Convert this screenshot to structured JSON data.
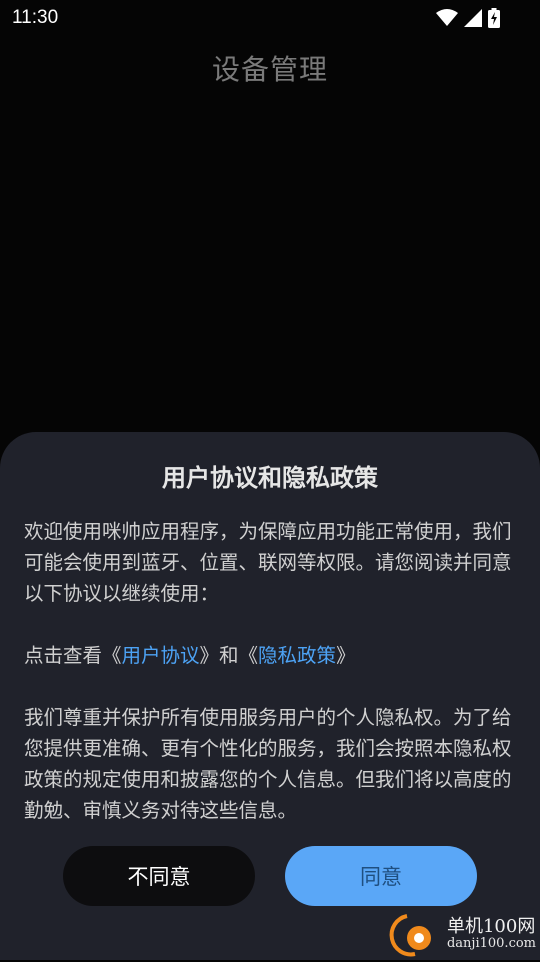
{
  "status_bar": {
    "time": "11:30",
    "icons": [
      "wifi-icon",
      "signal-icon",
      "battery-charging-icon"
    ]
  },
  "page": {
    "title": "设备管理"
  },
  "dialog": {
    "title": "用户协议和隐私政策",
    "intro": "欢迎使用咪帅应用程序，为保障应用功能正常使用，我们可能会使用到蓝牙、位置、联网等权限。请您阅读并同意以下协议以继续使用：",
    "links_prefix": "点击查看《",
    "user_agreement_link": "用户协议",
    "links_middle": "》和《",
    "privacy_policy_link": "隐私政策",
    "links_suffix": "》",
    "statement": "我们尊重并保护所有使用服务用户的个人隐私权。为了给您提供更准确、更有个性化的服务，我们会按照本隐私权政策的规定使用和披露您的个人信息。但我们将以高度的勤勉、审慎义务对待这些信息。",
    "disagree_label": "不同意",
    "agree_label": "同意"
  },
  "watermark": {
    "name": "单机100网",
    "url": "danji100.com"
  },
  "colors": {
    "background": "#050505",
    "dialog_bg": "#20222b",
    "link": "#4da3f5",
    "agree_button": "#5aa7f7",
    "disagree_button": "#0d0d0f"
  }
}
